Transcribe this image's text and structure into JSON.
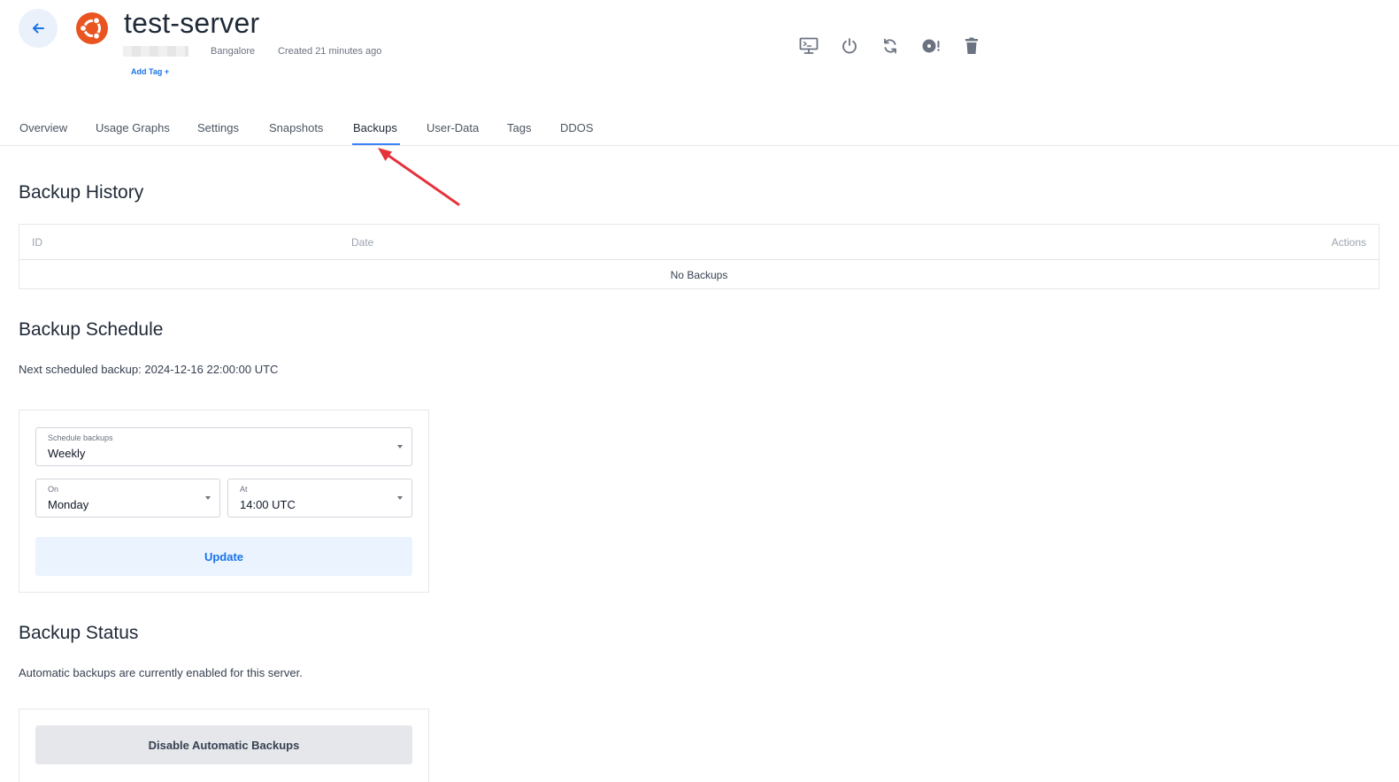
{
  "header": {
    "server_name": "test-server",
    "location": "Bangalore",
    "created": "Created 21 minutes ago",
    "add_tag": "Add Tag +"
  },
  "toolbar": {
    "icons": [
      "console-icon",
      "power-icon",
      "restart-icon",
      "reinstall-icon",
      "delete-icon"
    ]
  },
  "tabs": [
    {
      "label": "Overview"
    },
    {
      "label": "Usage Graphs"
    },
    {
      "label": "Settings"
    },
    {
      "label": "Snapshots"
    },
    {
      "label": "Backups",
      "active": true
    },
    {
      "label": "User-Data"
    },
    {
      "label": "Tags"
    },
    {
      "label": "DDOS"
    }
  ],
  "backup_history": {
    "title": "Backup History",
    "columns": {
      "id": "ID",
      "date": "Date",
      "actions": "Actions"
    },
    "empty_text": "No Backups"
  },
  "backup_schedule": {
    "title": "Backup Schedule",
    "next_backup": "Next scheduled backup: 2024-12-16 22:00:00 UTC",
    "schedule": {
      "label": "Schedule backups",
      "value": "Weekly"
    },
    "on": {
      "label": "On",
      "value": "Monday"
    },
    "at": {
      "label": "At",
      "value": "14:00 UTC"
    },
    "update_label": "Update"
  },
  "backup_status": {
    "title": "Backup Status",
    "status_text": "Automatic backups are currently enabled for this server.",
    "disable_label": "Disable Automatic Backups"
  },
  "colors": {
    "accent": "#1a73e8",
    "ubuntu_orange": "#e95420",
    "annotation_arrow": "#e5323b"
  }
}
